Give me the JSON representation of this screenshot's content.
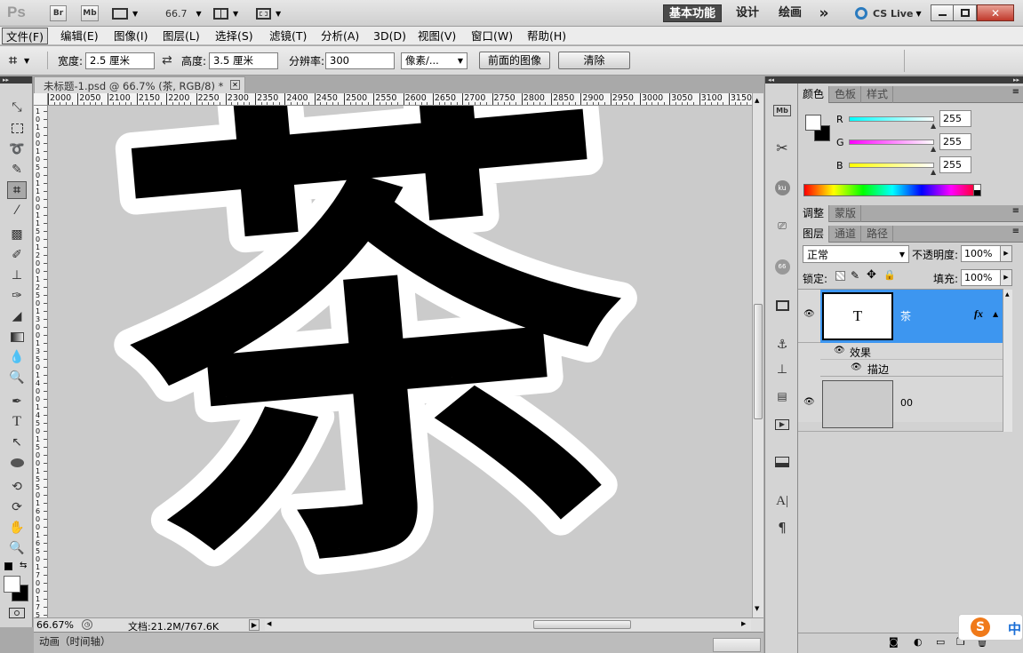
{
  "app_bar": {
    "logo": "Ps",
    "br_btn": "Br",
    "mb_btn": "Mb",
    "zoom_value": "66.7",
    "workspaces": [
      "基本功能",
      "设计",
      "绘画"
    ],
    "more": "»",
    "cs_live": "CS Live"
  },
  "menu": {
    "items": [
      "文件(F)",
      "编辑(E)",
      "图像(I)",
      "图层(L)",
      "选择(S)",
      "滤镜(T)",
      "分析(A)",
      "3D(D)",
      "视图(V)",
      "窗口(W)",
      "帮助(H)"
    ]
  },
  "options": {
    "width_label": "宽度:",
    "width_value": "2.5 厘米",
    "height_label": "高度:",
    "height_value": "3.5 厘米",
    "resolution_label": "分辨率:",
    "resolution_value": "300",
    "unit_value": "像素/...",
    "front_image_btn": "前面的图像",
    "clear_btn": "清除"
  },
  "document": {
    "tab_title": "未标题-1.psd @ 66.7% (茶, RGB/8) *",
    "glyph": "茶",
    "ruler_top": [
      "2000",
      "2050",
      "2100",
      "2150",
      "2200",
      "2250",
      "2300",
      "2350",
      "2400",
      "2450",
      "2500",
      "2550",
      "2600",
      "2650",
      "2700",
      "2750",
      "2800",
      "2850",
      "2900",
      "2950",
      "3000",
      "3050",
      "3100",
      "3150"
    ],
    "ruler_left": [
      "1",
      "0",
      "1",
      "0",
      "0",
      "1",
      "0",
      "5",
      "0",
      "1",
      "1",
      "0",
      "0",
      "1",
      "1",
      "5",
      "0",
      "1",
      "2",
      "0",
      "0",
      "1",
      "2",
      "5",
      "0",
      "1",
      "3",
      "0",
      "0",
      "1",
      "3",
      "5",
      "0",
      "1",
      "4",
      "0",
      "0",
      "1",
      "4",
      "5",
      "0",
      "1",
      "5",
      "0",
      "0",
      "1",
      "5",
      "5",
      "0",
      "1",
      "6",
      "0",
      "0",
      "1",
      "6",
      "5",
      "0",
      "1",
      "7",
      "0",
      "0",
      "1",
      "7",
      "5"
    ],
    "zoom_status": "66.67%",
    "doc_status": "文档:21.2M/767.6K",
    "anim_tab": "动画（时间轴）"
  },
  "color_panel": {
    "tabs": [
      "颜色",
      "色板",
      "样式"
    ],
    "channels": [
      {
        "label": "R",
        "value": "255"
      },
      {
        "label": "G",
        "value": "255"
      },
      {
        "label": "B",
        "value": "255"
      }
    ]
  },
  "adjust_panel": {
    "tabs": [
      "调整",
      "蒙版"
    ]
  },
  "layers_panel": {
    "tabs": [
      "图层",
      "通道",
      "路径"
    ],
    "blend_mode": "正常",
    "opacity_label": "不透明度:",
    "opacity_value": "100%",
    "lock_label": "锁定:",
    "fill_label": "填充:",
    "fill_value": "100%",
    "layers": [
      {
        "name": "茶",
        "thumb": "T",
        "fx": "fx",
        "effects_label": "效果",
        "effect": "描边"
      },
      {
        "name": "00"
      }
    ]
  },
  "ime": {
    "logo": "S",
    "mode": "中"
  }
}
